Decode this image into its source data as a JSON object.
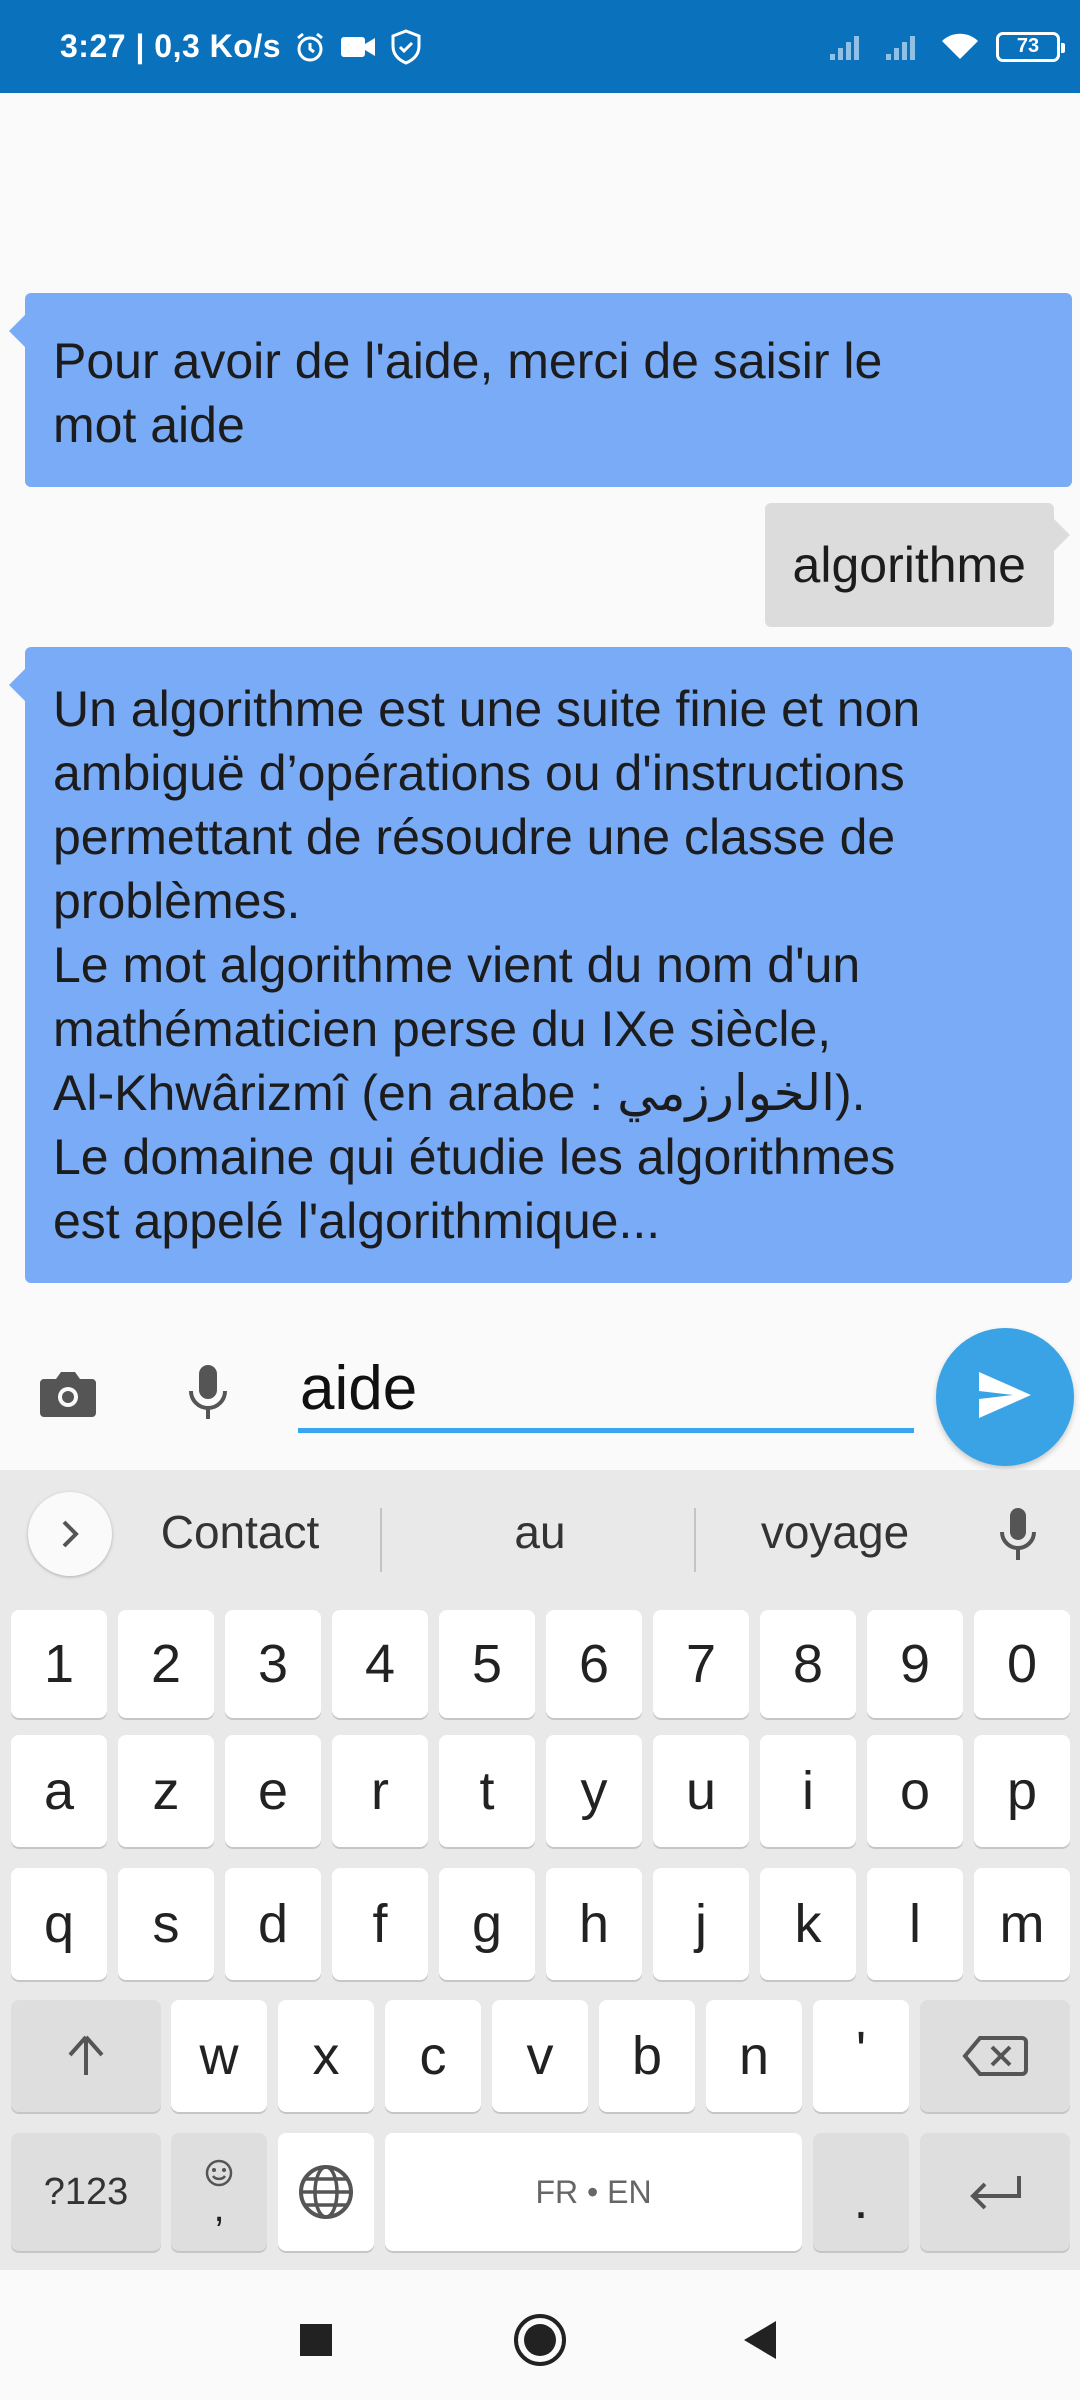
{
  "status_bar": {
    "time_speed": "3:27 | 0,3 Ko/s",
    "battery": "73",
    "icons": [
      "alarm-icon",
      "video-icon",
      "shield-icon",
      "signal-icon",
      "signal-icon",
      "wifi-icon",
      "battery-icon"
    ]
  },
  "chat": {
    "messages": [
      {
        "sender": "bot",
        "text": "Pour avoir de l'aide, merci de saisir le\nmot aide"
      },
      {
        "sender": "user",
        "text": "algorithme"
      },
      {
        "sender": "bot",
        "text": "Un algorithme est une suite finie et non\nambiguë d’opérations ou d'instructions\npermettant de résoudre une classe de\nproblèmes.\nLe mot algorithme vient du nom d'un\nmathématicien perse du IXe siècle,\nAl-Khwârizmî (en arabe : الخوارزمي).\nLe domaine qui étudie les algorithmes\nest appelé l'algorithmique..."
      }
    ]
  },
  "input": {
    "value": "aide",
    "icons": [
      "camera-icon",
      "microphone-icon",
      "send-icon"
    ]
  },
  "keyboard": {
    "suggestions": [
      "Contact",
      "au",
      "voyage"
    ],
    "row_numbers": [
      "1",
      "2",
      "3",
      "4",
      "5",
      "6",
      "7",
      "8",
      "9",
      "0"
    ],
    "row1": [
      "a",
      "z",
      "e",
      "r",
      "t",
      "y",
      "u",
      "i",
      "o",
      "p"
    ],
    "row2": [
      "q",
      "s",
      "d",
      "f",
      "g",
      "h",
      "j",
      "k",
      "l",
      "m"
    ],
    "row3": [
      "w",
      "x",
      "c",
      "v",
      "b",
      "n",
      "'"
    ],
    "symbols_key": "?123",
    "comma_key": ",",
    "space_label": "FR • EN",
    "period_key": "."
  },
  "colors": {
    "status_bar": "#0a72bc",
    "bot_bubble": "#7aabf7",
    "user_bubble": "#dcdcdc",
    "send_button": "#3aa3e6",
    "input_underline": "#38a6f0"
  }
}
